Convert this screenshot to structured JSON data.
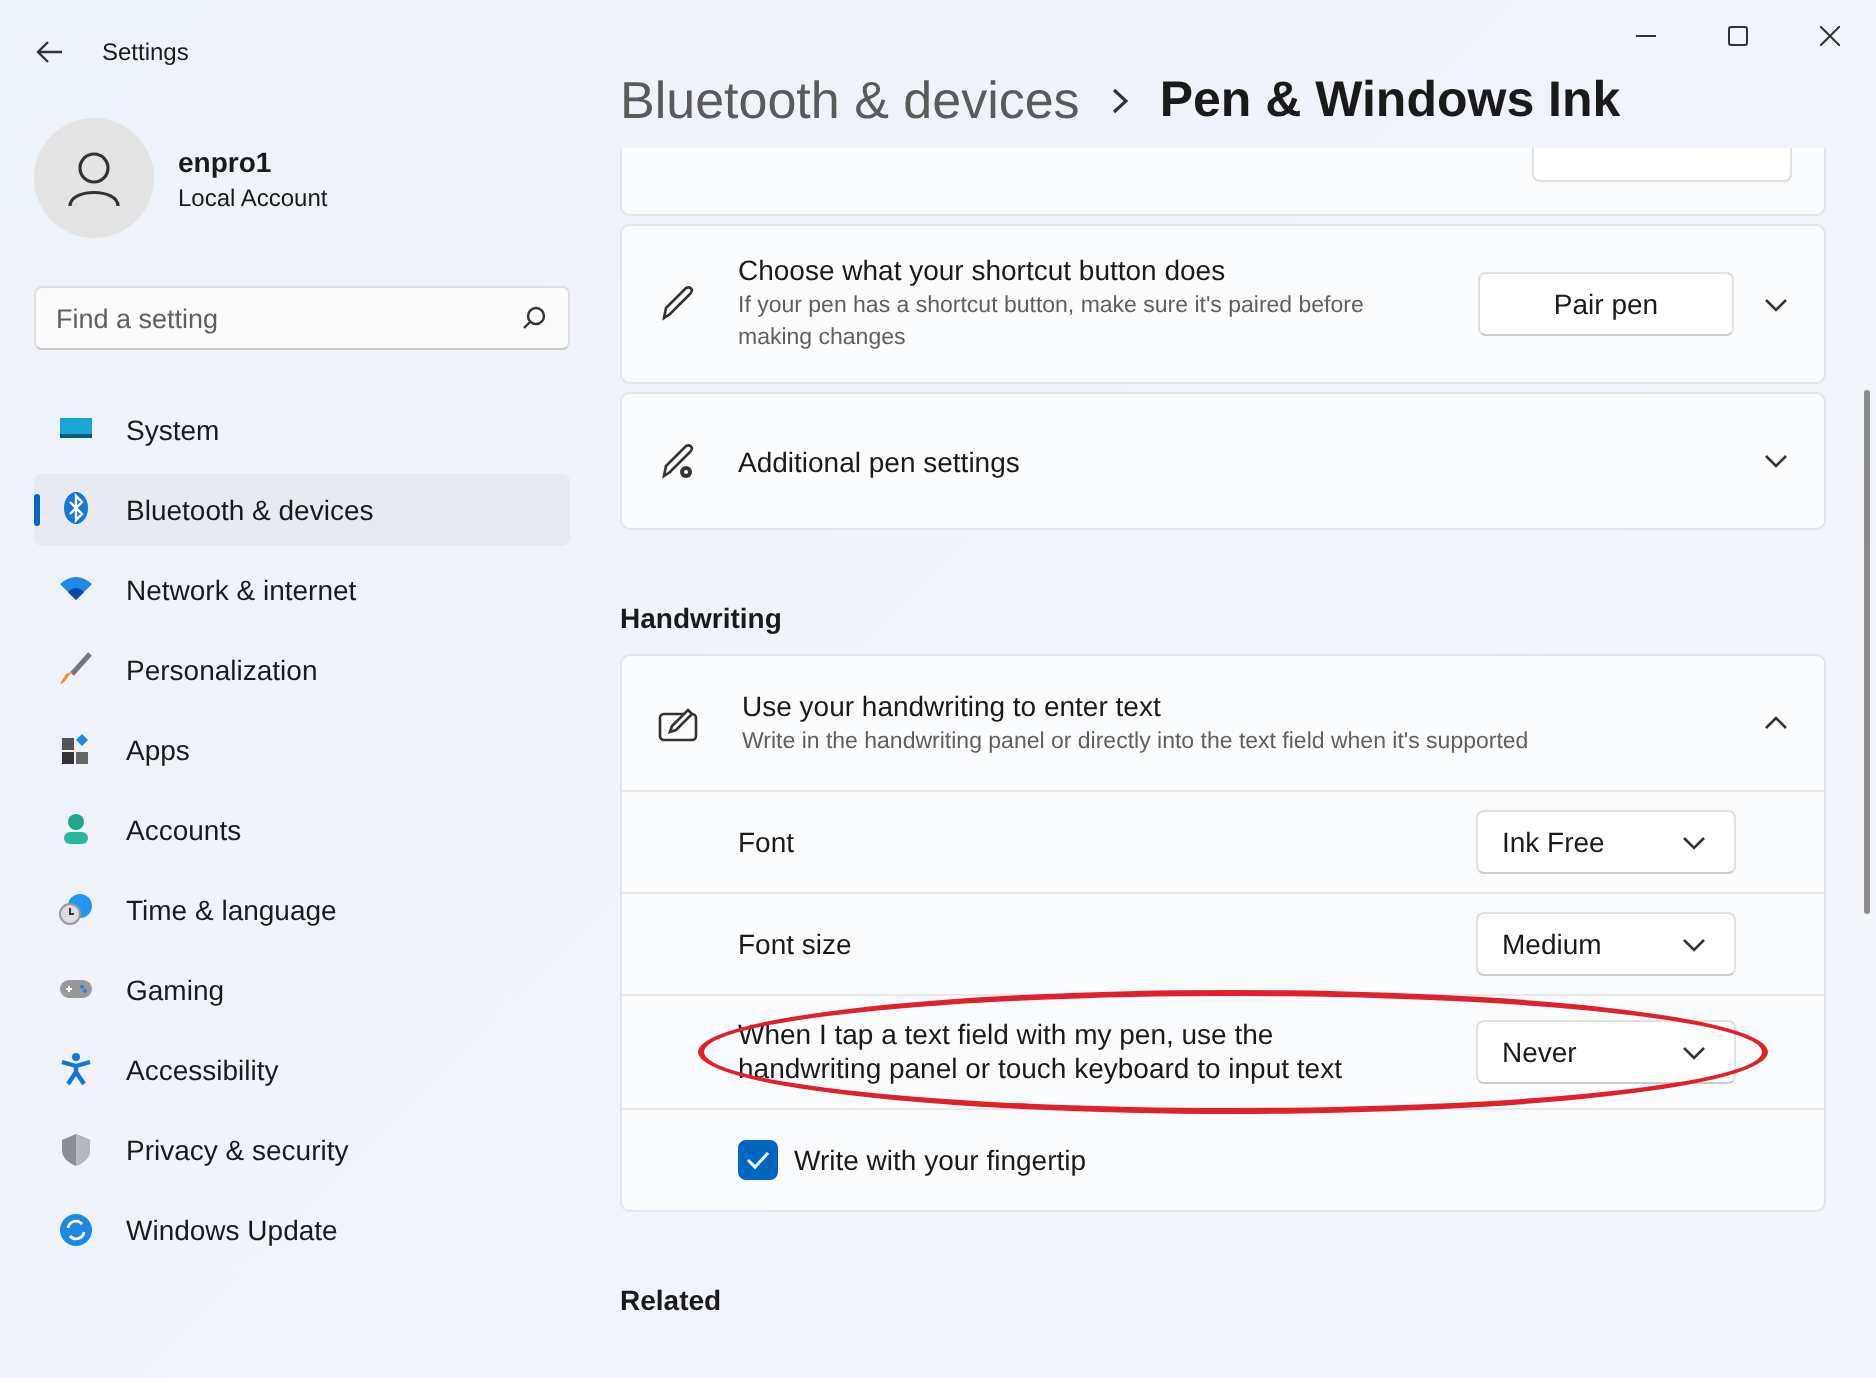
{
  "window": {
    "title": "Settings"
  },
  "profile": {
    "name": "enpro1",
    "account_type": "Local Account"
  },
  "search": {
    "placeholder": "Find a setting"
  },
  "sidebar": {
    "items": [
      {
        "label": "System",
        "selected": false
      },
      {
        "label": "Bluetooth & devices",
        "selected": true
      },
      {
        "label": "Network & internet",
        "selected": false
      },
      {
        "label": "Personalization",
        "selected": false
      },
      {
        "label": "Apps",
        "selected": false
      },
      {
        "label": "Accounts",
        "selected": false
      },
      {
        "label": "Time & language",
        "selected": false
      },
      {
        "label": "Gaming",
        "selected": false
      },
      {
        "label": "Accessibility",
        "selected": false
      },
      {
        "label": "Privacy & security",
        "selected": false
      },
      {
        "label": "Windows Update",
        "selected": false
      }
    ]
  },
  "breadcrumb": {
    "parent": "Bluetooth & devices",
    "current": "Pen & Windows Ink"
  },
  "cards": [
    {
      "kind": "partial"
    },
    {
      "kind": "action",
      "title": "Choose what your shortcut button does",
      "description": "If your pen has a shortcut button, make sure it's paired before making changes",
      "button": "Pair pen",
      "expanded": false
    },
    {
      "kind": "expander",
      "title": "Additional pen settings",
      "expanded": false
    }
  ],
  "sections": [
    {
      "heading": "Handwriting",
      "card": {
        "title": "Use your handwriting to enter text",
        "description": "Write in the handwriting panel or directly into the text field when it's supported",
        "expanded": true,
        "rows": [
          {
            "kind": "dropdown",
            "label": "Font",
            "value": "Ink Free",
            "highlighted": false
          },
          {
            "kind": "dropdown",
            "label": "Font size",
            "value": "Medium",
            "highlighted": false
          },
          {
            "kind": "dropdown",
            "label": "When I tap a text field with my pen, use the handwriting panel or touch keyboard to input text",
            "value": "Never",
            "highlighted": true
          },
          {
            "kind": "checkbox",
            "label": "Write with your fingertip",
            "checked": true
          }
        ]
      }
    },
    {
      "heading": "Related"
    }
  ]
}
